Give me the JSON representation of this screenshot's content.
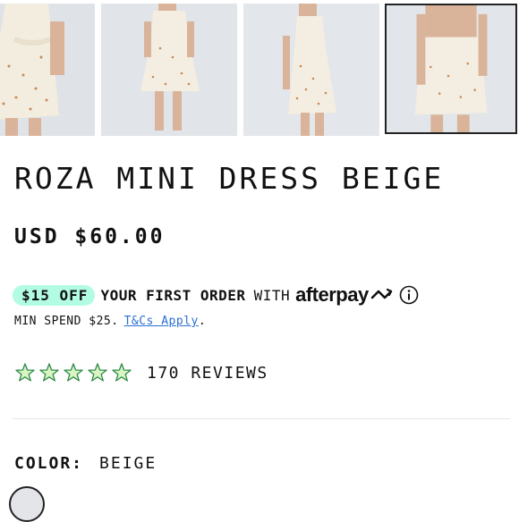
{
  "product": {
    "title": "ROZA MINI DRESS BEIGE",
    "price": "USD $60.00"
  },
  "promo": {
    "badge": "$15 OFF",
    "text": "YOUR FIRST ORDER",
    "with": "WITH",
    "brand": "afterpay",
    "min_spend": "MIN SPEND $25.",
    "tcs_link": "T&Cs Apply",
    "tcs_suffix": "."
  },
  "rating": {
    "stars": 5,
    "reviews": "170 REVIEWS"
  },
  "color": {
    "label": "COLOR:",
    "value": "BEIGE",
    "swatch": "#e3e5e8"
  },
  "colors": {
    "badge_bg": "#b2fce4",
    "link": "#2a6ed1",
    "star_stroke": "#2e8a4a",
    "star_fill": "#d8f5c2"
  },
  "icons": [
    "afterpay-logo-icon",
    "info-icon",
    "star-icon"
  ]
}
